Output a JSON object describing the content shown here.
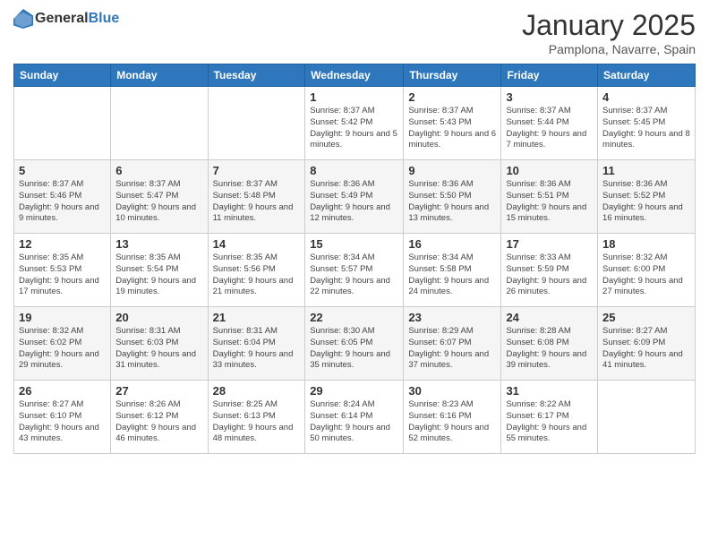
{
  "logo": {
    "general": "General",
    "blue": "Blue"
  },
  "title": "January 2025",
  "location": "Pamplona, Navarre, Spain",
  "days_of_week": [
    "Sunday",
    "Monday",
    "Tuesday",
    "Wednesday",
    "Thursday",
    "Friday",
    "Saturday"
  ],
  "weeks": [
    [
      {
        "day": "",
        "sunrise": "",
        "sunset": "",
        "daylight": ""
      },
      {
        "day": "",
        "sunrise": "",
        "sunset": "",
        "daylight": ""
      },
      {
        "day": "",
        "sunrise": "",
        "sunset": "",
        "daylight": ""
      },
      {
        "day": "1",
        "sunrise": "Sunrise: 8:37 AM",
        "sunset": "Sunset: 5:42 PM",
        "daylight": "Daylight: 9 hours and 5 minutes."
      },
      {
        "day": "2",
        "sunrise": "Sunrise: 8:37 AM",
        "sunset": "Sunset: 5:43 PM",
        "daylight": "Daylight: 9 hours and 6 minutes."
      },
      {
        "day": "3",
        "sunrise": "Sunrise: 8:37 AM",
        "sunset": "Sunset: 5:44 PM",
        "daylight": "Daylight: 9 hours and 7 minutes."
      },
      {
        "day": "4",
        "sunrise": "Sunrise: 8:37 AM",
        "sunset": "Sunset: 5:45 PM",
        "daylight": "Daylight: 9 hours and 8 minutes."
      }
    ],
    [
      {
        "day": "5",
        "sunrise": "Sunrise: 8:37 AM",
        "sunset": "Sunset: 5:46 PM",
        "daylight": "Daylight: 9 hours and 9 minutes."
      },
      {
        "day": "6",
        "sunrise": "Sunrise: 8:37 AM",
        "sunset": "Sunset: 5:47 PM",
        "daylight": "Daylight: 9 hours and 10 minutes."
      },
      {
        "day": "7",
        "sunrise": "Sunrise: 8:37 AM",
        "sunset": "Sunset: 5:48 PM",
        "daylight": "Daylight: 9 hours and 11 minutes."
      },
      {
        "day": "8",
        "sunrise": "Sunrise: 8:36 AM",
        "sunset": "Sunset: 5:49 PM",
        "daylight": "Daylight: 9 hours and 12 minutes."
      },
      {
        "day": "9",
        "sunrise": "Sunrise: 8:36 AM",
        "sunset": "Sunset: 5:50 PM",
        "daylight": "Daylight: 9 hours and 13 minutes."
      },
      {
        "day": "10",
        "sunrise": "Sunrise: 8:36 AM",
        "sunset": "Sunset: 5:51 PM",
        "daylight": "Daylight: 9 hours and 15 minutes."
      },
      {
        "day": "11",
        "sunrise": "Sunrise: 8:36 AM",
        "sunset": "Sunset: 5:52 PM",
        "daylight": "Daylight: 9 hours and 16 minutes."
      }
    ],
    [
      {
        "day": "12",
        "sunrise": "Sunrise: 8:35 AM",
        "sunset": "Sunset: 5:53 PM",
        "daylight": "Daylight: 9 hours and 17 minutes."
      },
      {
        "day": "13",
        "sunrise": "Sunrise: 8:35 AM",
        "sunset": "Sunset: 5:54 PM",
        "daylight": "Daylight: 9 hours and 19 minutes."
      },
      {
        "day": "14",
        "sunrise": "Sunrise: 8:35 AM",
        "sunset": "Sunset: 5:56 PM",
        "daylight": "Daylight: 9 hours and 21 minutes."
      },
      {
        "day": "15",
        "sunrise": "Sunrise: 8:34 AM",
        "sunset": "Sunset: 5:57 PM",
        "daylight": "Daylight: 9 hours and 22 minutes."
      },
      {
        "day": "16",
        "sunrise": "Sunrise: 8:34 AM",
        "sunset": "Sunset: 5:58 PM",
        "daylight": "Daylight: 9 hours and 24 minutes."
      },
      {
        "day": "17",
        "sunrise": "Sunrise: 8:33 AM",
        "sunset": "Sunset: 5:59 PM",
        "daylight": "Daylight: 9 hours and 26 minutes."
      },
      {
        "day": "18",
        "sunrise": "Sunrise: 8:32 AM",
        "sunset": "Sunset: 6:00 PM",
        "daylight": "Daylight: 9 hours and 27 minutes."
      }
    ],
    [
      {
        "day": "19",
        "sunrise": "Sunrise: 8:32 AM",
        "sunset": "Sunset: 6:02 PM",
        "daylight": "Daylight: 9 hours and 29 minutes."
      },
      {
        "day": "20",
        "sunrise": "Sunrise: 8:31 AM",
        "sunset": "Sunset: 6:03 PM",
        "daylight": "Daylight: 9 hours and 31 minutes."
      },
      {
        "day": "21",
        "sunrise": "Sunrise: 8:31 AM",
        "sunset": "Sunset: 6:04 PM",
        "daylight": "Daylight: 9 hours and 33 minutes."
      },
      {
        "day": "22",
        "sunrise": "Sunrise: 8:30 AM",
        "sunset": "Sunset: 6:05 PM",
        "daylight": "Daylight: 9 hours and 35 minutes."
      },
      {
        "day": "23",
        "sunrise": "Sunrise: 8:29 AM",
        "sunset": "Sunset: 6:07 PM",
        "daylight": "Daylight: 9 hours and 37 minutes."
      },
      {
        "day": "24",
        "sunrise": "Sunrise: 8:28 AM",
        "sunset": "Sunset: 6:08 PM",
        "daylight": "Daylight: 9 hours and 39 minutes."
      },
      {
        "day": "25",
        "sunrise": "Sunrise: 8:27 AM",
        "sunset": "Sunset: 6:09 PM",
        "daylight": "Daylight: 9 hours and 41 minutes."
      }
    ],
    [
      {
        "day": "26",
        "sunrise": "Sunrise: 8:27 AM",
        "sunset": "Sunset: 6:10 PM",
        "daylight": "Daylight: 9 hours and 43 minutes."
      },
      {
        "day": "27",
        "sunrise": "Sunrise: 8:26 AM",
        "sunset": "Sunset: 6:12 PM",
        "daylight": "Daylight: 9 hours and 46 minutes."
      },
      {
        "day": "28",
        "sunrise": "Sunrise: 8:25 AM",
        "sunset": "Sunset: 6:13 PM",
        "daylight": "Daylight: 9 hours and 48 minutes."
      },
      {
        "day": "29",
        "sunrise": "Sunrise: 8:24 AM",
        "sunset": "Sunset: 6:14 PM",
        "daylight": "Daylight: 9 hours and 50 minutes."
      },
      {
        "day": "30",
        "sunrise": "Sunrise: 8:23 AM",
        "sunset": "Sunset: 6:16 PM",
        "daylight": "Daylight: 9 hours and 52 minutes."
      },
      {
        "day": "31",
        "sunrise": "Sunrise: 8:22 AM",
        "sunset": "Sunset: 6:17 PM",
        "daylight": "Daylight: 9 hours and 55 minutes."
      },
      {
        "day": "",
        "sunrise": "",
        "sunset": "",
        "daylight": ""
      }
    ]
  ]
}
